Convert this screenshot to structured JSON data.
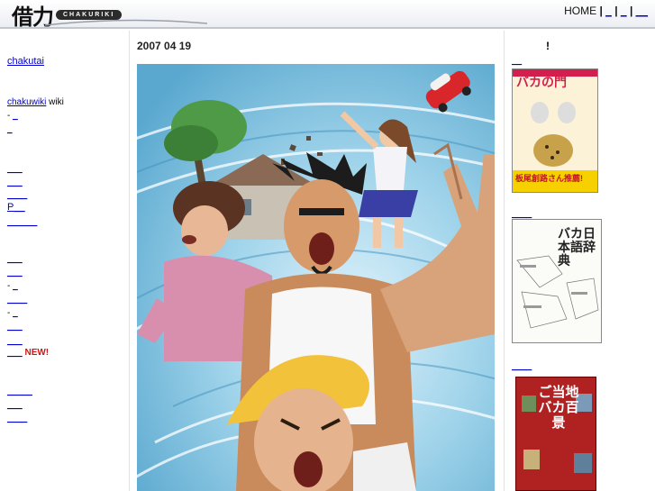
{
  "header": {
    "logo_kanji": "借力",
    "logo_text": "CHAKURIKI",
    "nav": {
      "home": "HOME",
      "sep1": "|",
      "link1": "_",
      "sep2": "|",
      "link2": "_",
      "sep3": "|",
      "link3": "__"
    }
  },
  "sidebar": {
    "chakutai": "chakutai",
    "chakuwiki": "chakuwiki",
    "chakuwiki_suffix": "wiki",
    "dash1": "-",
    "link_a": "_",
    "link_b": "_",
    "group1": [
      "___",
      "___",
      "____"
    ],
    "p_link": "P",
    "p_link_suffix": "__",
    "group1_last": "______",
    "group2_a": [
      "___",
      "___"
    ],
    "dash2": "-",
    "link_c": "_",
    "group2_b": "____",
    "dash3": "-",
    "link_d": "_",
    "group2_c": [
      "___",
      "___"
    ],
    "new_link": "___",
    "new_badge": "NEW!",
    "group3": [
      "_____",
      "___",
      "____"
    ]
  },
  "main": {
    "date": "2007 04 19"
  },
  "right": {
    "heading": "!",
    "link1": "__",
    "link2": "____",
    "link3": "____",
    "book1": {
      "title": "バカの門",
      "banner": "板尾創路さん推薦!"
    },
    "book2": {
      "title": "バカ日本語辞典"
    },
    "book3": {
      "title": "ご当地バカ百景"
    }
  },
  "colors": {
    "link": "#0000cc",
    "new_badge": "#d01515",
    "header_border": "#c2c6ce"
  }
}
